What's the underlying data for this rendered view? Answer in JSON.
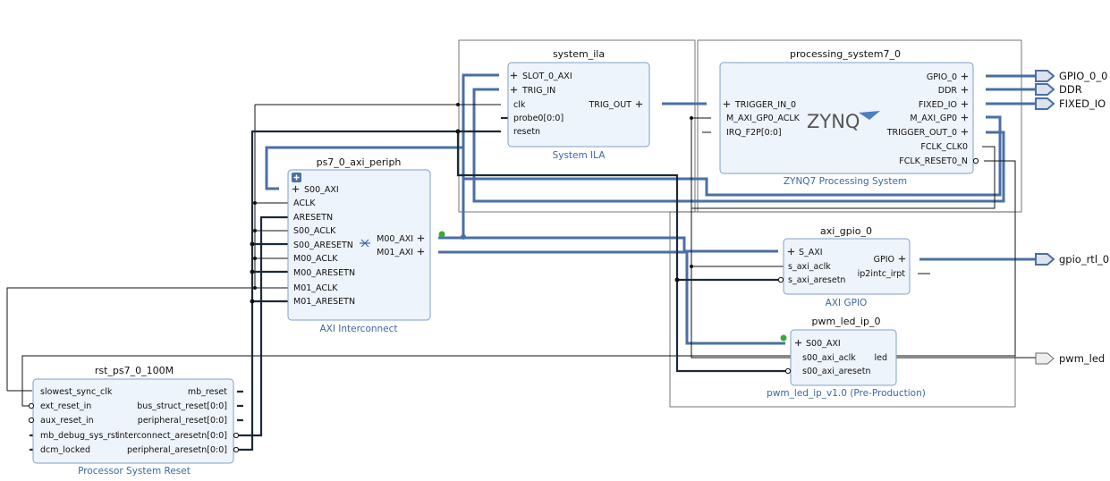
{
  "blocks": {
    "system_ila": {
      "name": "system_ila",
      "subtitle": "System ILA",
      "ports_left": [
        "SLOT_0_AXI",
        "TRIG_IN",
        "clk",
        "probe0[0:0]",
        "resetn"
      ],
      "ports_right": [
        "TRIG_OUT"
      ]
    },
    "ps7": {
      "name": "processing_system7_0",
      "subtitle": "ZYNQ7 Processing System",
      "logo": "ZYNQ",
      "ports_left": [
        "TRIGGER_IN_0",
        "M_AXI_GP0_ACLK",
        "IRQ_F2P[0:0]"
      ],
      "ports_right": [
        "GPIO_0",
        "DDR",
        "FIXED_IO",
        "M_AXI_GP0",
        "TRIGGER_OUT_0",
        "FCLK_CLK0",
        "FCLK_RESET0_N"
      ]
    },
    "axi_periph": {
      "name": "ps7_0_axi_periph",
      "subtitle": "AXI Interconnect",
      "ports_left": [
        "S00_AXI",
        "ACLK",
        "ARESETN",
        "S00_ACLK",
        "S00_ARESETN",
        "M00_ACLK",
        "M00_ARESETN",
        "M01_ACLK",
        "M01_ARESETN"
      ],
      "ports_right": [
        "M00_AXI",
        "M01_AXI"
      ]
    },
    "axi_gpio": {
      "name": "axi_gpio_0",
      "subtitle": "AXI GPIO",
      "ports_left": [
        "S_AXI",
        "s_axi_aclk",
        "s_axi_aresetn"
      ],
      "ports_right": [
        "GPIO",
        "ip2intc_irpt"
      ]
    },
    "pwm": {
      "name": "pwm_led_ip_0",
      "subtitle": "pwm_led_ip_v1.0 (Pre-Production)",
      "ports_left": [
        "S00_AXI",
        "s00_axi_aclk",
        "s00_axi_aresetn"
      ],
      "ports_right": [
        "led"
      ]
    },
    "rst": {
      "name": "rst_ps7_0_100M",
      "subtitle": "Processor System Reset",
      "ports_left": [
        "slowest_sync_clk",
        "ext_reset_in",
        "aux_reset_in",
        "mb_debug_sys_rst",
        "dcm_locked"
      ],
      "ports_right": [
        "mb_reset",
        "bus_struct_reset[0:0]",
        "peripheral_reset[0:0]",
        "interconnect_aresetn[0:0]",
        "peripheral_aresetn[0:0]"
      ]
    }
  },
  "external_ports": [
    "GPIO_0_0",
    "DDR",
    "FIXED_IO",
    "gpio_rtl_0",
    "pwm_led"
  ],
  "colors": {
    "block_fill": "#eef4fb",
    "block_border": "#7f9fc8",
    "bus": "#4a6fa5",
    "subtitle": "#3b67a8"
  }
}
